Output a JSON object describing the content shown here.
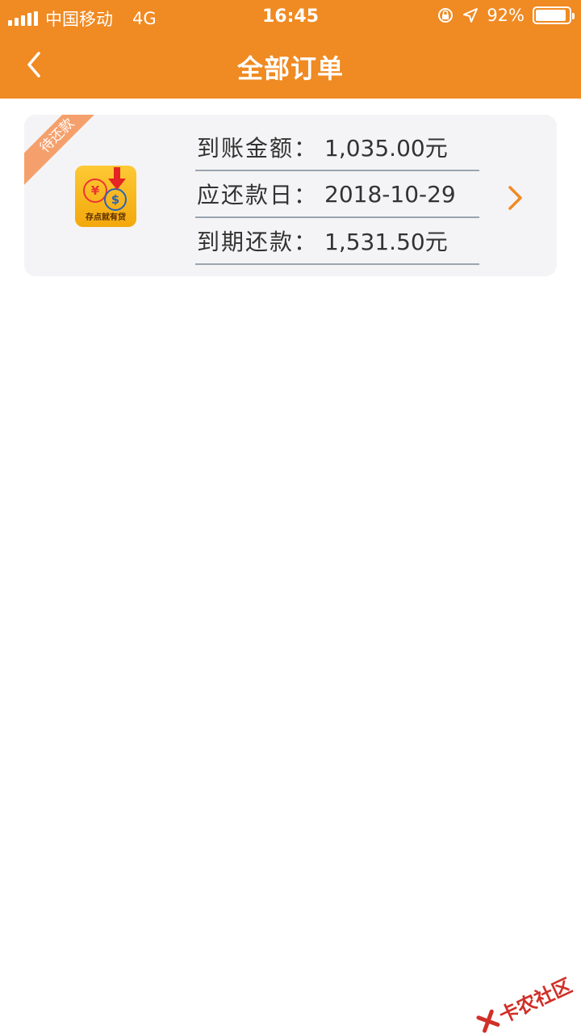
{
  "status_bar": {
    "carrier": "中国移动",
    "network": "4G",
    "time": "16:45",
    "battery": "92%",
    "battery_level": 0.92
  },
  "nav": {
    "back_icon": "chevron-left-icon",
    "title": "全部订单"
  },
  "order": {
    "status_ribbon": "待还款",
    "logo_caption": "存点就有贷",
    "fields": [
      {
        "label": "到账金额：",
        "value": "1,035.00元"
      },
      {
        "label": "应还款日：",
        "value": "2018-10-29"
      },
      {
        "label": "到期还款：",
        "value": "1,531.50元"
      }
    ],
    "arrow_icon": "chevron-right-icon"
  },
  "watermark": {
    "text": "卡农社区"
  },
  "colors": {
    "brand": "#f08a22",
    "ribbon": "#f5a06c",
    "card_bg": "#f4f4f6",
    "divider": "#9aa4b0"
  }
}
